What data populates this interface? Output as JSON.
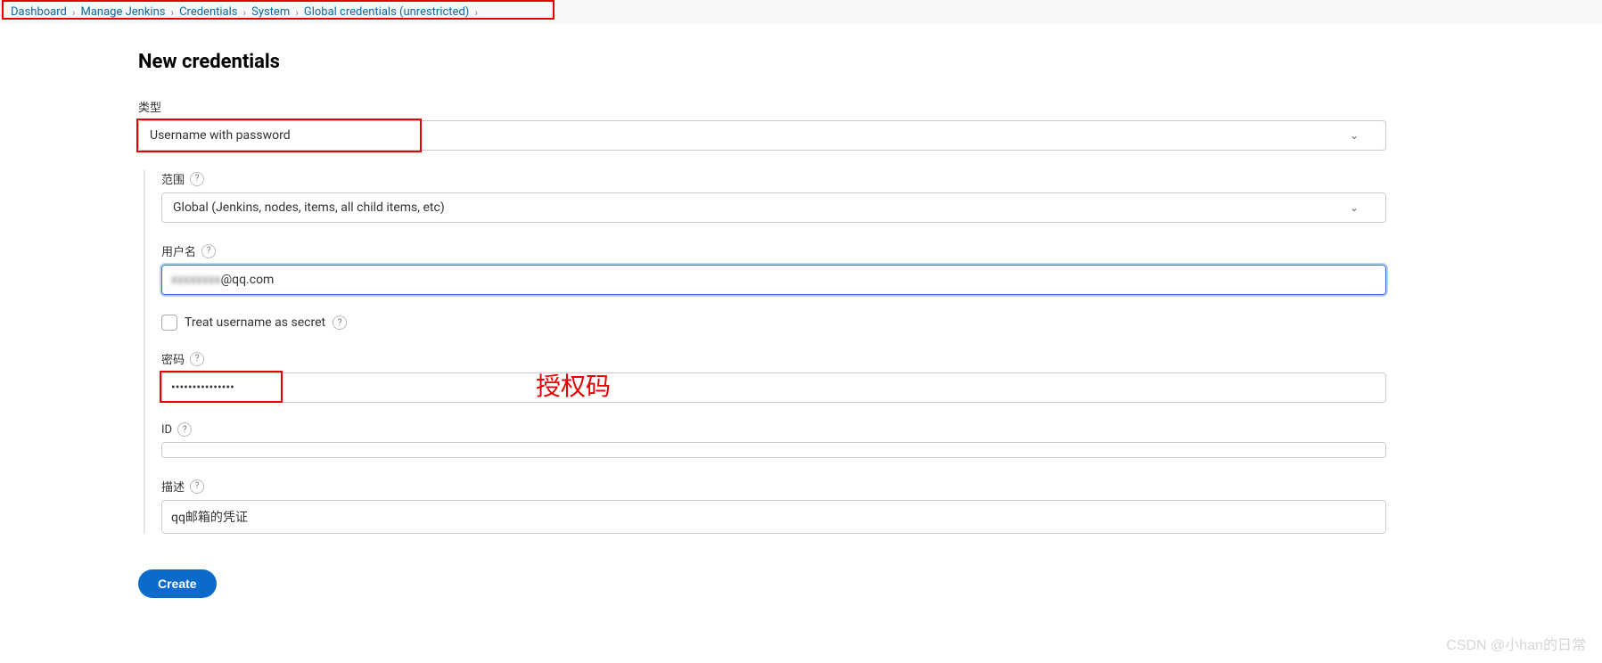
{
  "breadcrumb": {
    "items": [
      "Dashboard",
      "Manage Jenkins",
      "Credentials",
      "System",
      "Global credentials (unrestricted)"
    ]
  },
  "heading": "New credentials",
  "labels": {
    "type": "类型",
    "scope": "范围",
    "username": "用户名",
    "treat_secret": "Treat username as secret",
    "password": "密码",
    "id": "ID",
    "description": "描述"
  },
  "fields": {
    "type_value": "Username with password",
    "scope_value": "Global (Jenkins, nodes, items, all child items, etc)",
    "username_value_suffix": "@qq.com",
    "password_value": "•••••••••••••••",
    "id_value": "",
    "description_value": "qq邮箱的凭证"
  },
  "annotations": {
    "password_note": "授权码"
  },
  "buttons": {
    "create": "Create"
  },
  "watermark": "CSDN @小han的日常",
  "help_glyph": "?"
}
